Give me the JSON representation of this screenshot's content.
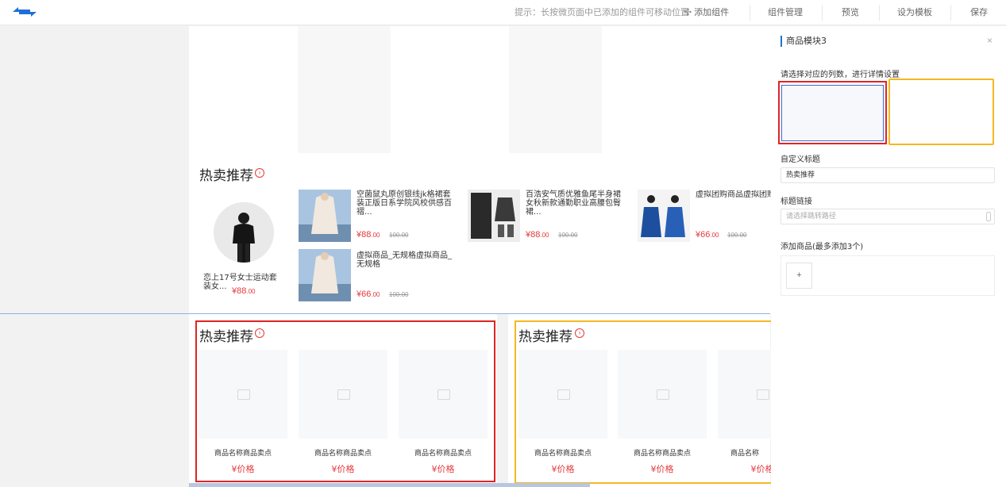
{
  "topbar": {
    "hint": "提示：长按微页面中已添加的组件可移动位置",
    "add_component": "添加组件",
    "manage": "组件管理",
    "preview": "预览",
    "set_template": "设为模板",
    "save": "保存"
  },
  "hot": {
    "title": "热卖推荐",
    "featured": {
      "name": "恋上17号女士运动套装女...",
      "price": "88",
      "price_dec": ".00"
    },
    "items": [
      {
        "name": "空菌鼠丸原创银线jk格裙套装正版日系学院风校供感百褶...",
        "price": "88",
        "price_dec": ".00",
        "original": "100.00"
      },
      {
        "name": "百浩安气质优雅鱼尾半身裙女秋新款通勤职业高腰包臀裙...",
        "price": "88",
        "price_dec": ".00",
        "original": "100.00"
      },
      {
        "name": "虚拟团购商品虚拟团购商品",
        "price": "66",
        "price_dec": ".00",
        "original": "100.00"
      },
      {
        "name": "虚拟商品_无规格虚拟商品_无规格",
        "price": "66",
        "price_dec": ".00",
        "original": "100.00"
      }
    ]
  },
  "modules": {
    "left": {
      "title": "热卖推荐",
      "cards": [
        {
          "name": "商品名称商品卖点",
          "price": "¥价格"
        },
        {
          "name": "商品名称商品卖点",
          "price": "¥价格"
        },
        {
          "name": "商品名称商品卖点",
          "price": "¥价格"
        }
      ]
    },
    "right": {
      "title": "热卖推荐",
      "cards": [
        {
          "name": "商品名称商品卖点",
          "price": "¥价格"
        },
        {
          "name": "商品名称商品卖点",
          "price": "¥价格"
        },
        {
          "name": "商品名称",
          "price": "¥价格"
        }
      ]
    }
  },
  "panel": {
    "title": "商品模块3",
    "close": "×",
    "columns_label": "请选择对应的列数，进行详情设置",
    "custom_title_label": "自定义标题",
    "custom_title_value": "热卖推荐",
    "link_label": "标题链接",
    "link_placeholder": "请选择跳转路径",
    "add_goods_label": "添加商品(最多添加3个)",
    "add_button": "+"
  },
  "currency": "¥",
  "colors": {
    "accent": "#e4393c",
    "brand": "#1e73d8",
    "selected_red": "#e02424",
    "selected_yellow": "#f5b820"
  }
}
